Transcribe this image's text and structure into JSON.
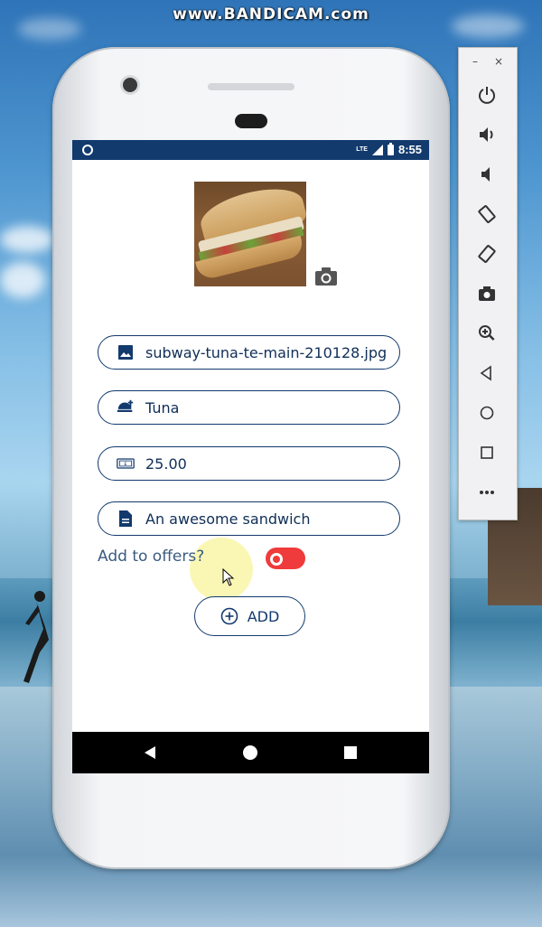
{
  "watermark": "www.BANDICAM.com",
  "status": {
    "time": "8:55",
    "network": "LTE"
  },
  "form": {
    "image_name": "subway-tuna-te-main-210128.jpg",
    "name": "Tuna",
    "price": "25.00",
    "description": "An awesome sandwich",
    "offers_label": "Add to offers?",
    "offers_enabled": false,
    "add_label": "ADD"
  },
  "emulator": {
    "close": "×",
    "minimize": "–",
    "buttons": [
      "power",
      "volume-up",
      "volume-down",
      "rotate-left",
      "rotate-right",
      "screenshot",
      "zoom",
      "back",
      "home",
      "overview",
      "more"
    ]
  },
  "colors": {
    "primary": "#123a6d",
    "toggle_off": "#ef3b3b"
  }
}
